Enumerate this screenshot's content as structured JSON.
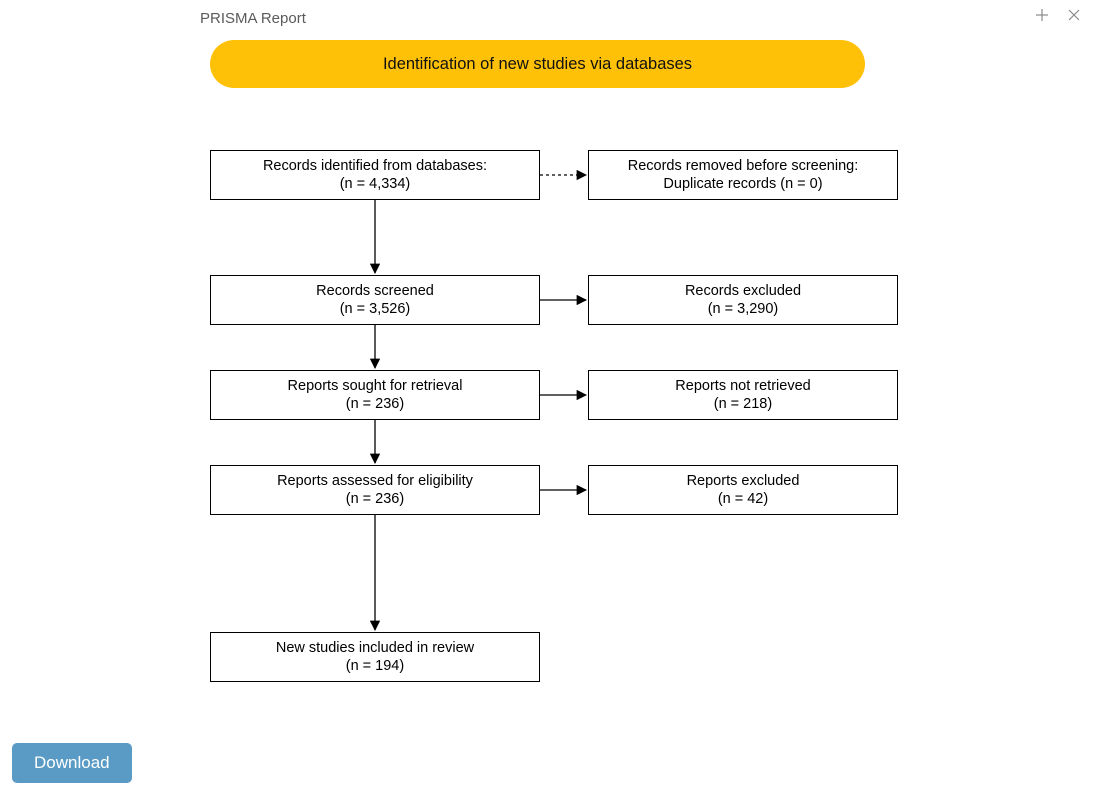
{
  "title": "PRISMA Report",
  "banner": "Identification of new studies via databases",
  "boxes": {
    "b1_line1": "Records identified from databases:",
    "b1_line2": "(n = 4,334)",
    "b2_line1": "Records screened",
    "b2_line2": "(n = 3,526)",
    "b3_line1": "Reports sought for retrieval",
    "b3_line2": "(n = 236)",
    "b4_line1": "Reports assessed for eligibility",
    "b4_line2": "(n = 236)",
    "b5_line1": "New studies included in review",
    "b5_line2": "(n = 194)",
    "r1_line1": "Records removed before screening:",
    "r1_line2": "Duplicate records (n = 0)",
    "r2_line1": "Records excluded",
    "r2_line2": "(n = 3,290)",
    "r3_line1": "Reports not retrieved",
    "r3_line2": "(n = 218)",
    "r4_line1": "Reports excluded",
    "r4_line2": "(n = 42)"
  },
  "download_label": "Download"
}
